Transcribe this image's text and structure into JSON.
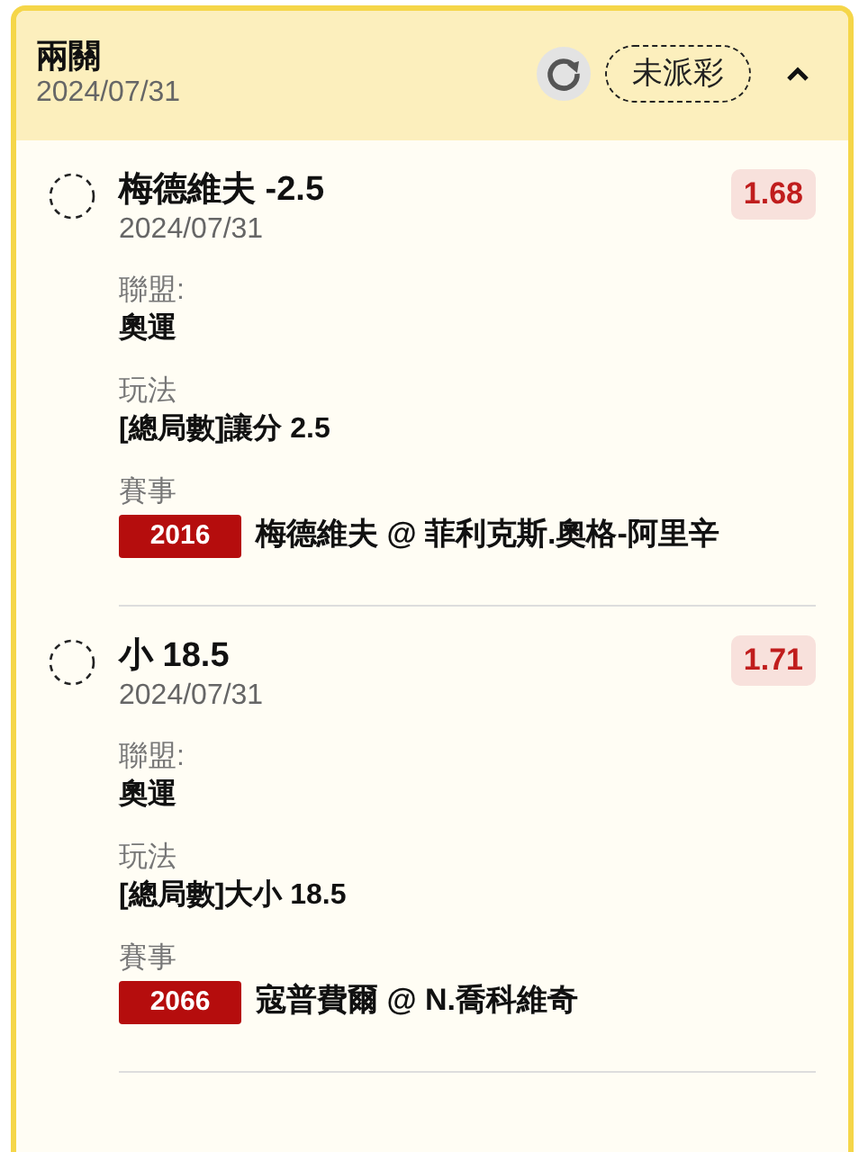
{
  "header": {
    "title": "兩關",
    "date": "2024/07/31",
    "status": "未派彩",
    "expanded": true
  },
  "legs": [
    {
      "selection": "梅德維夫 -2.5",
      "date": "2024/07/31",
      "odds": "1.68",
      "league_label": "聯盟:",
      "league": "奧運",
      "bet_type_label": "玩法",
      "bet_type": "[總局數]讓分 2.5",
      "event_label": "賽事",
      "event_no": "2016",
      "event": "梅德維夫 @ 菲利克斯.奧格-阿里辛"
    },
    {
      "selection": "小 18.5",
      "date": "2024/07/31",
      "odds": "1.71",
      "league_label": "聯盟:",
      "league": "奧運",
      "bet_type_label": "玩法",
      "bet_type": "[總局數]大小 18.5",
      "event_label": "賽事",
      "event_no": "2066",
      "event": "寇普費爾 @ N.喬科維奇"
    }
  ]
}
